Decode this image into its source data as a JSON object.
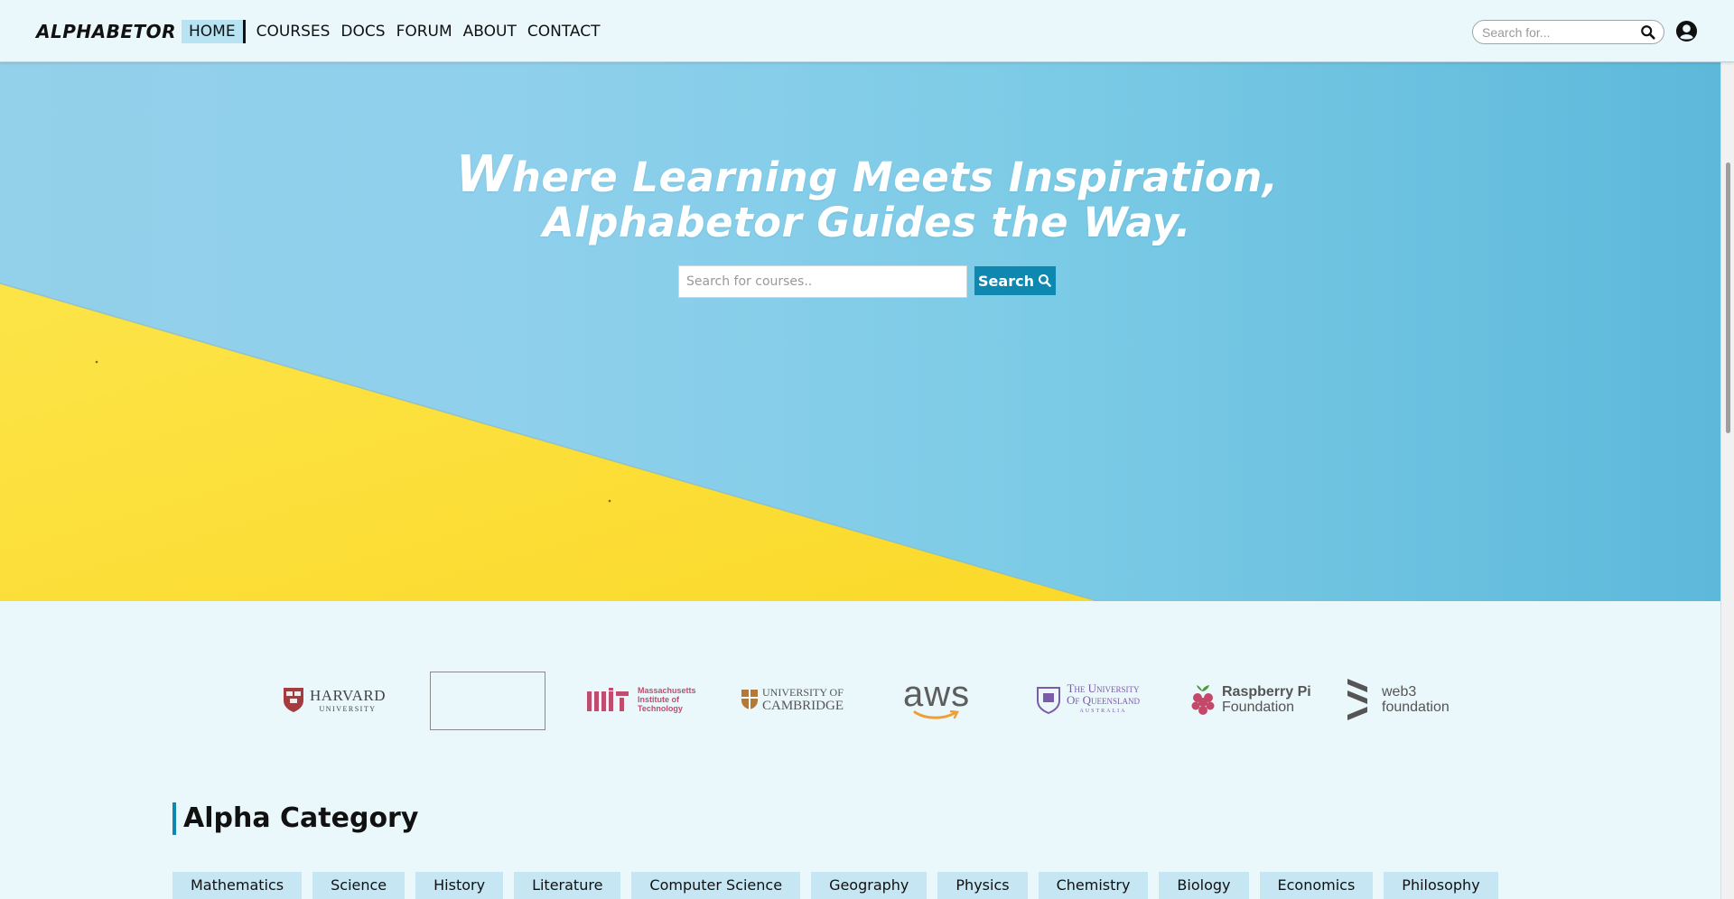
{
  "nav": {
    "brand": "ALPHABETOR",
    "links": [
      "HOME",
      "COURSES",
      "DOCS",
      "FORUM",
      "ABOUT",
      "CONTACT"
    ],
    "active_link": "HOME",
    "search_placeholder": "Search for...",
    "search_icon": "search-icon",
    "user_icon": "user-circle-icon"
  },
  "hero": {
    "title_first_letter": "W",
    "title_line1_rest": "here Learning Meets Inspiration,",
    "title_line2": "Alphabetor Guides the Way.",
    "search_placeholder": "Search for courses..",
    "search_button_label": "Search",
    "colors": {
      "sky": "#8fd0ec",
      "yellow": "#fde03a"
    }
  },
  "partners": {
    "harvard": {
      "name": "HARVARD",
      "sub": "UNIVERSITY"
    },
    "mit": {
      "mark": "MIT",
      "lines": [
        "Massachusetts",
        "Institute of",
        "Technology"
      ]
    },
    "cambridge": {
      "line1": "UNIVERSITY OF",
      "line2": "CAMBRIDGE"
    },
    "aws": {
      "name": "aws"
    },
    "queensland": {
      "line1": "The University",
      "line2": "Of Queensland",
      "line3": "AUSTRALIA"
    },
    "raspberry": {
      "line1": "Raspberry Pi",
      "line2": "Foundation"
    },
    "web3": {
      "line1": "web3",
      "line2": "foundation"
    }
  },
  "category": {
    "title": "Alpha Category",
    "items": [
      "Mathematics",
      "Science",
      "History",
      "Literature",
      "Computer Science",
      "Geography",
      "Physics",
      "Chemistry",
      "Biology",
      "Economics",
      "Philosophy"
    ]
  },
  "colors": {
    "accent": "#0e87b1",
    "page_bg": "#eaf7fb",
    "chip_bg": "#c5e6f2"
  }
}
